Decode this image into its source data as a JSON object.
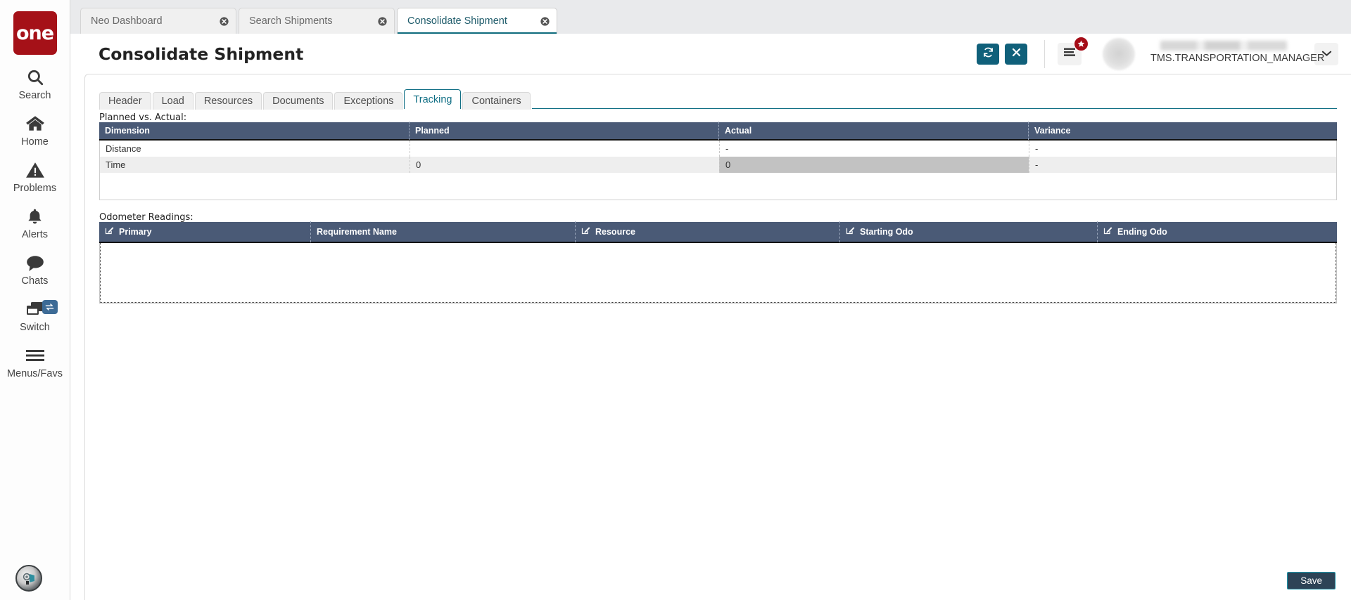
{
  "brand": {
    "logo_text": "one",
    "logo_color": "#a51118"
  },
  "rail": {
    "items": [
      {
        "label": "Search",
        "icon": "search-icon"
      },
      {
        "label": "Home",
        "icon": "home-icon"
      },
      {
        "label": "Problems",
        "icon": "warning-triangle-icon"
      },
      {
        "label": "Alerts",
        "icon": "bell-icon"
      },
      {
        "label": "Chats",
        "icon": "chat-bubble-icon"
      },
      {
        "label": "Switch",
        "icon": "windows-stack-icon",
        "badge_icon": "swap-arrows-icon"
      },
      {
        "label": "Menus/Favs",
        "icon": "hamburger-icon"
      }
    ],
    "assistant_icon": "assistant-avatar-icon"
  },
  "browser_tabs": [
    {
      "label": "Neo Dashboard",
      "active": false,
      "close_icon": "close-circle-icon"
    },
    {
      "label": "Search Shipments",
      "active": false,
      "close_icon": "close-circle-icon"
    },
    {
      "label": "Consolidate Shipment",
      "active": true,
      "close_icon": "close-circle-icon"
    }
  ],
  "header": {
    "title": "Consolidate Shipment",
    "refresh_icon": "refresh-icon",
    "close_icon": "close-x-icon",
    "menu_icon": "list-menu-icon",
    "star_badge_icon": "star-icon",
    "user_role": "TMS.TRANSPORTATION_MANAGER",
    "caret_icon": "chevron-down-icon",
    "accent_teal": "#10607a"
  },
  "content_tabs": [
    {
      "label": "Header",
      "active": false
    },
    {
      "label": "Load",
      "active": false
    },
    {
      "label": "Resources",
      "active": false
    },
    {
      "label": "Documents",
      "active": false
    },
    {
      "label": "Exceptions",
      "active": false
    },
    {
      "label": "Tracking",
      "active": true
    },
    {
      "label": "Containers",
      "active": false
    }
  ],
  "planned_vs_actual": {
    "section_label": "Planned vs. Actual:",
    "columns": [
      "Dimension",
      "Planned",
      "Actual",
      "Variance"
    ],
    "rows": [
      {
        "Dimension": "Distance",
        "Planned": "",
        "Actual": "-",
        "Variance": "-",
        "selected": ""
      },
      {
        "Dimension": "Time",
        "Planned": "0",
        "Actual": "0",
        "Variance": "-",
        "selected": "Actual"
      }
    ]
  },
  "odometer_readings": {
    "section_label": "Odometer Readings:",
    "columns": [
      {
        "label": "Primary",
        "edit_icon": "pencil-square-icon"
      },
      {
        "label": "Requirement Name",
        "edit_icon": ""
      },
      {
        "label": "Resource",
        "edit_icon": "pencil-square-icon"
      },
      {
        "label": "Starting Odo",
        "edit_icon": "pencil-square-icon"
      },
      {
        "label": "Ending Odo",
        "edit_icon": "pencil-square-icon"
      }
    ],
    "rows": []
  },
  "footer": {
    "save_label": "Save"
  }
}
